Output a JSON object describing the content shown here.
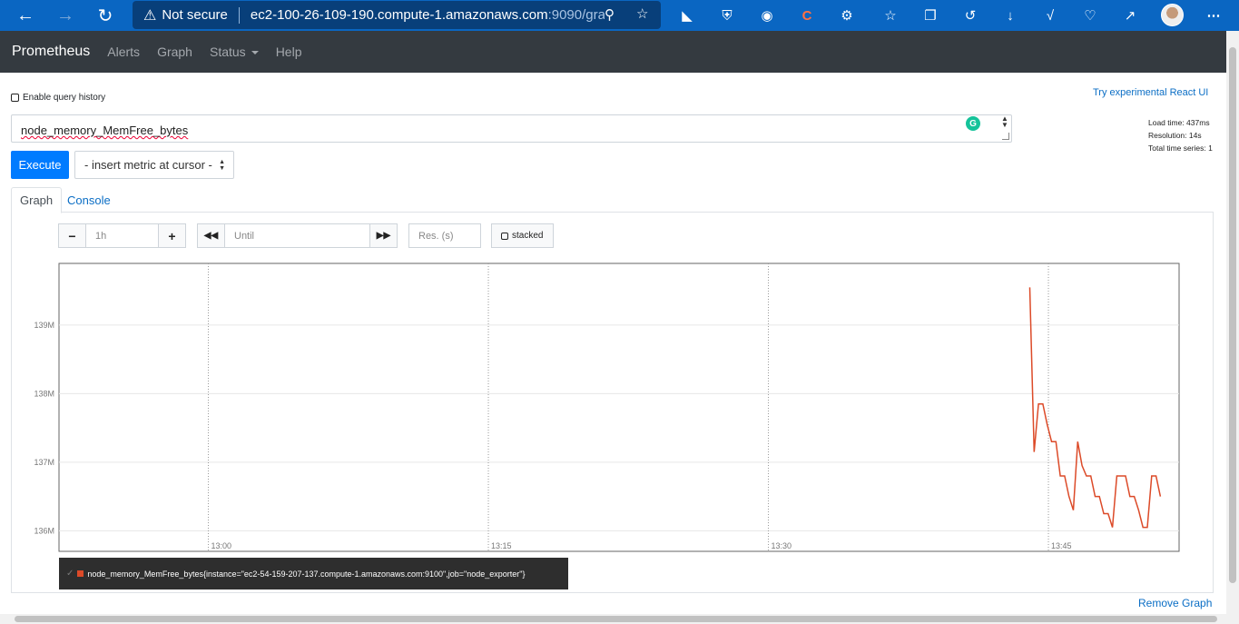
{
  "browser": {
    "security_label": "Not secure",
    "url_host": "ec2-100-26-109-190.compute-1.amazonaws.com",
    "url_rest": ":9090/gra...",
    "icons": [
      "back-icon",
      "forward-icon",
      "refresh-icon",
      "warning-icon",
      "zoom-icon",
      "favorite-add-icon",
      "extension-icon",
      "collections-icon",
      "history-icon",
      "download-icon",
      "settings-icon",
      "more-icon"
    ]
  },
  "navbar": {
    "brand": "Prometheus",
    "links": [
      "Alerts",
      "Graph",
      "Status",
      "Help"
    ]
  },
  "query": {
    "history_label": "Enable query history",
    "react_link": "Try experimental React UI",
    "expression": "node_memory_MemFree_bytes",
    "execute_label": "Execute",
    "metric_select": "- insert metric at cursor -",
    "stats": {
      "load_time": "Load time: 437ms",
      "resolution": "Resolution: 14s",
      "total_series": "Total time series: 1"
    }
  },
  "tabs": {
    "graph": "Graph",
    "console": "Console"
  },
  "controls": {
    "range": "1h",
    "until_placeholder": "Until",
    "res_placeholder": "Res. (s)",
    "stacked_label": "stacked"
  },
  "chart_data": {
    "type": "line",
    "title": "",
    "xlabel": "",
    "ylabel": "",
    "x_ticks": [
      "13:00",
      "13:15",
      "13:30",
      "13:45"
    ],
    "y_ticks": [
      "136M",
      "137M",
      "138M",
      "139M"
    ],
    "xlim": [
      "12:52",
      "13:52"
    ],
    "ylim": [
      135.7,
      139.9
    ],
    "grid": true,
    "series": [
      {
        "name": "node_memory_MemFree_bytes{instance=\"ec2-54-159-207-137.compute-1.amazonaws.com:9100\",job=\"node_exporter\"}",
        "color": "#dc4a28",
        "x": [
          "13:44:00",
          "13:44:14",
          "13:44:28",
          "13:44:42",
          "13:44:56",
          "13:45:10",
          "13:45:24",
          "13:45:38",
          "13:45:52",
          "13:46:06",
          "13:46:20",
          "13:46:34",
          "13:46:48",
          "13:47:02",
          "13:47:16",
          "13:47:30",
          "13:47:44",
          "13:47:58",
          "13:48:12",
          "13:48:26",
          "13:48:40",
          "13:48:54",
          "13:49:08",
          "13:49:22",
          "13:49:36",
          "13:49:50",
          "13:50:04",
          "13:50:18",
          "13:50:32",
          "13:50:46",
          "13:51:00"
        ],
        "values": [
          139.55,
          137.15,
          137.85,
          137.85,
          137.55,
          137.3,
          137.3,
          136.8,
          136.8,
          136.5,
          136.3,
          137.3,
          136.95,
          136.8,
          136.8,
          136.5,
          136.5,
          136.25,
          136.25,
          136.05,
          136.8,
          136.8,
          136.8,
          136.5,
          136.5,
          136.3,
          136.05,
          136.05,
          136.8,
          136.8,
          136.5
        ]
      }
    ]
  },
  "legend": {
    "entry": "node_memory_MemFree_bytes{instance=\"ec2-54-159-207-137.compute-1.amazonaws.com:9100\",job=\"node_exporter\"}"
  },
  "remove_graph": "Remove Graph"
}
